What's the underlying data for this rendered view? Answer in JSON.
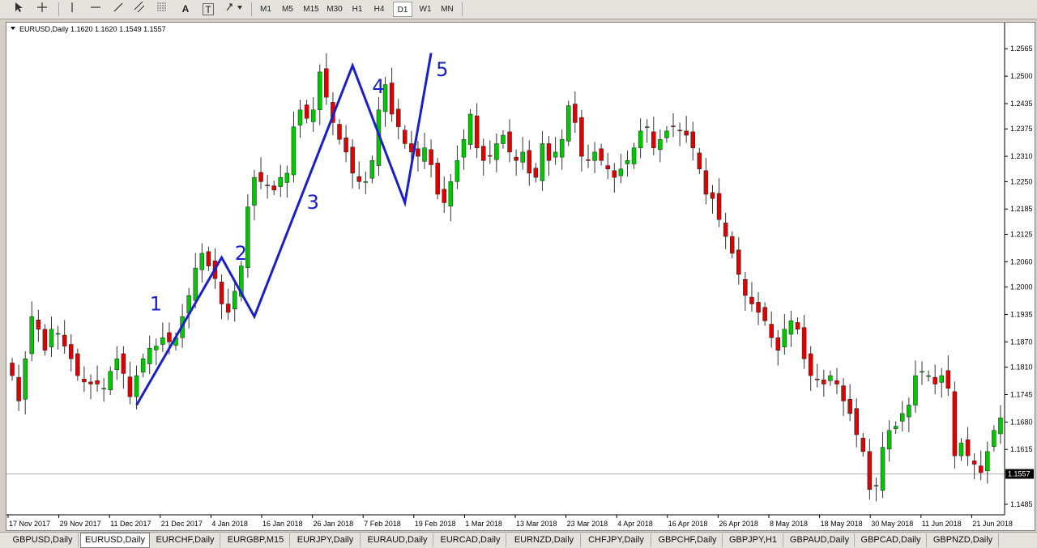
{
  "toolbar": {
    "tools": [
      {
        "name": "cursor-tool",
        "icon": "arrow-cursor-icon"
      },
      {
        "name": "crosshair-tool",
        "icon": "crosshair-icon"
      },
      {
        "name": "vertical-line-tool",
        "icon": "vertical-line-icon"
      },
      {
        "name": "horizontal-line-tool",
        "icon": "horizontal-line-icon"
      },
      {
        "name": "trendline-tool",
        "icon": "trendline-icon"
      },
      {
        "name": "equidistant-channel-tool",
        "icon": "channel-icon"
      },
      {
        "name": "fibonacci-tool",
        "icon": "fibonacci-icon"
      },
      {
        "name": "text-tool",
        "icon": "text-icon",
        "label": "A"
      },
      {
        "name": "text-label-tool",
        "icon": "text-label-icon",
        "label": "T"
      },
      {
        "name": "arrows-tool",
        "icon": "arrows-icon"
      }
    ],
    "timeframes": [
      "M1",
      "M5",
      "M15",
      "M30",
      "H1",
      "H4",
      "D1",
      "W1",
      "MN"
    ],
    "active_timeframe": "D1"
  },
  "chart": {
    "header": "EURUSD,Daily  1.1620 1.1620 1.1549 1.1557",
    "current_price": "1.1557",
    "colors": {
      "bull": "#00c800",
      "bear": "#e00000",
      "wave": "#1a20c8",
      "wick": "#333333",
      "price_line": "#b0b0b0"
    },
    "wave_labels": [
      "1",
      "2",
      "3",
      "4",
      "5"
    ],
    "y_ticks": [
      "1.2565",
      "1.2500",
      "1.2435",
      "1.2375",
      "1.2310",
      "1.2250",
      "1.2185",
      "1.2125",
      "1.2060",
      "1.2000",
      "1.1935",
      "1.1870",
      "1.1810",
      "1.1745",
      "1.1680",
      "1.1615",
      "1.1485"
    ],
    "x_ticks": [
      "17 Nov 2017",
      "29 Nov 2017",
      "11 Dec 2017",
      "21 Dec 2017",
      "4 Jan 2018",
      "16 Jan 2018",
      "26 Jan 2018",
      "7 Feb 2018",
      "19 Feb 2018",
      "1 Mar 2018",
      "13 Mar 2018",
      "23 Mar 2018",
      "4 Apr 2018",
      "16 Apr 2018",
      "26 Apr 2018",
      "8 May 2018",
      "18 May 2018",
      "30 May 2018",
      "11 Jun 2018",
      "21 Jun 2018"
    ]
  },
  "chart_data": {
    "type": "candlestick",
    "symbol": "EURUSD",
    "timeframe": "Daily",
    "ylim": [
      1.146,
      1.26
    ],
    "close_series": [
      1.179,
      1.173,
      1.183,
      1.193,
      1.19,
      1.185,
      1.19,
      1.189,
      1.186,
      1.183,
      1.179,
      1.1775,
      1.177,
      1.177,
      1.176,
      1.18,
      1.183,
      1.1795,
      1.174,
      1.179,
      1.183,
      1.1855,
      1.186,
      1.188,
      1.187,
      1.188,
      1.193,
      1.198,
      1.2045,
      1.208,
      1.205,
      1.202,
      1.196,
      1.194,
      1.199,
      1.205,
      1.219,
      1.226,
      1.225,
      1.224,
      1.223,
      1.226,
      1.227,
      1.238,
      1.242,
      1.24,
      1.242,
      1.251,
      1.245,
      1.239,
      1.235,
      1.232,
      1.227,
      1.225,
      1.225,
      1.23,
      1.242,
      1.248,
      1.241,
      1.238,
      1.234,
      1.232,
      1.231,
      1.233,
      1.229,
      1.222,
      1.22,
      1.225,
      1.23,
      1.235,
      1.241,
      1.233,
      1.23,
      1.231,
      1.234,
      1.236,
      1.232,
      1.23,
      1.232,
      1.227,
      1.226,
      1.234,
      1.23,
      1.232,
      1.235,
      1.243,
      1.239,
      1.231,
      1.23,
      1.232,
      1.23,
      1.228,
      1.226,
      1.228,
      1.23,
      1.233,
      1.237,
      1.238,
      1.233,
      1.235,
      1.237,
      1.238,
      1.237,
      1.236,
      1.233,
      1.228,
      1.222,
      1.221,
      1.216,
      1.212,
      1.208,
      1.203,
      1.198,
      1.196,
      1.194,
      1.192,
      1.188,
      1.185,
      1.19,
      1.192,
      1.19,
      1.183,
      1.179,
      1.178,
      1.177,
      1.179,
      1.177,
      1.173,
      1.17,
      1.165,
      1.161,
      1.152,
      1.153,
      1.162,
      1.166,
      1.167,
      1.17,
      1.172,
      1.179,
      1.18,
      1.179,
      1.177,
      1.179,
      1.176,
      1.16,
      1.163,
      1.16,
      1.158,
      1.156,
      1.161,
      1.166,
      1.169
    ]
  }
}
